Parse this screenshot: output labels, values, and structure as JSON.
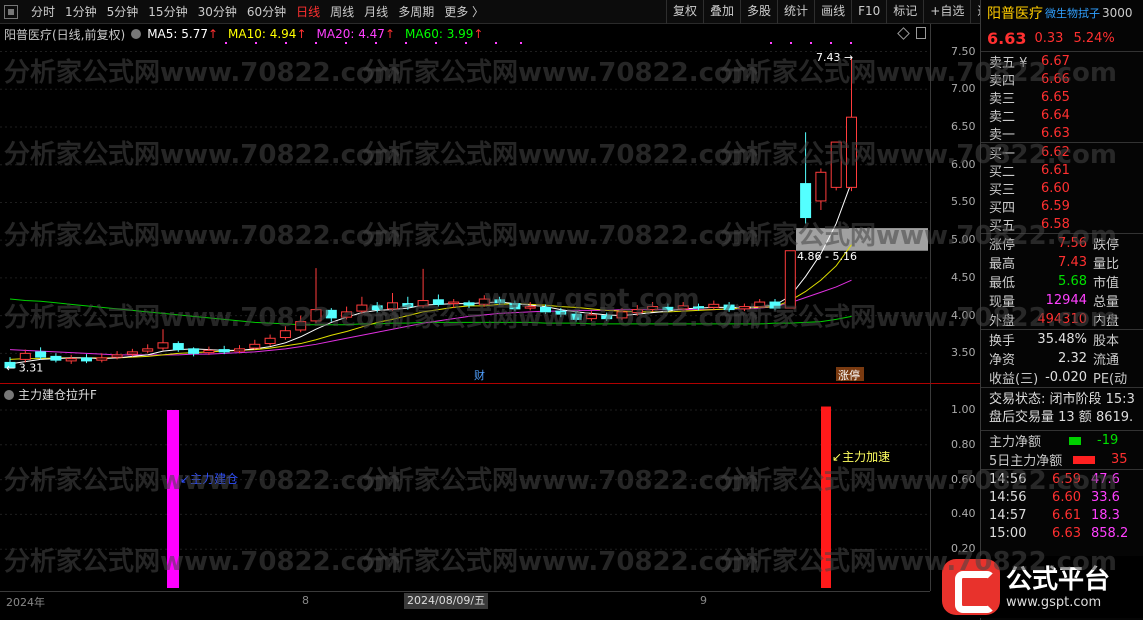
{
  "toolbar": {
    "periods": [
      "分时",
      "1分钟",
      "5分钟",
      "15分钟",
      "30分钟",
      "60分钟",
      "日线",
      "周线",
      "月线",
      "多周期",
      "更多 〉"
    ],
    "active_index": 6,
    "buttons": [
      "复权",
      "叠加",
      "多股",
      "统计",
      "画线",
      "F10",
      "标记",
      "+自选",
      "返回"
    ]
  },
  "chart_header": {
    "stock": "阳普医疗(日线,前复权)",
    "ma5": "MA5: 5.77",
    "ma10": "MA10: 4.94",
    "ma20": "MA20: 4.47",
    "ma60": "MA60: 3.99",
    "arrow": "↑"
  },
  "price_axis": [
    "7.50",
    "7.00",
    "6.50",
    "6.00",
    "5.50",
    "5.00",
    "4.50",
    "4.00",
    "3.50"
  ],
  "annotations": {
    "high": "7.43",
    "low": "3.31",
    "range": "4.86 - 5.16",
    "marker_cai": "财",
    "marker_limit": "涨停"
  },
  "sub_indicator": {
    "title": "主力建仓拉升F",
    "signal_left": "主力建仓",
    "signal_right": "主力加速",
    "axis": [
      "1.00",
      "0.80",
      "0.60",
      "0.40",
      "0.20"
    ],
    "bar_values": [
      1.0,
      1.02
    ]
  },
  "date_axis": {
    "labels": [
      "2024年",
      "8",
      "9"
    ],
    "cursor": "2024/08/09/五"
  },
  "chart_data": {
    "type": "candlestick",
    "series": [
      {
        "name": "MA5",
        "color": "#ffffff"
      },
      {
        "name": "MA10",
        "color": "#ffff00"
      },
      {
        "name": "MA20",
        "color": "#ff40ff"
      },
      {
        "name": "MA60",
        "color": "#00ff00"
      }
    ],
    "ylim": [
      3.2,
      7.6
    ],
    "candles": [
      [
        3.38,
        3.31,
        3.45,
        3.3
      ],
      [
        3.42,
        3.5,
        3.55,
        3.38
      ],
      [
        3.52,
        3.45,
        3.58,
        3.42
      ],
      [
        3.46,
        3.41,
        3.5,
        3.38
      ],
      [
        3.4,
        3.43,
        3.48,
        3.36
      ],
      [
        3.44,
        3.4,
        3.49,
        3.37
      ],
      [
        3.41,
        3.44,
        3.5,
        3.38
      ],
      [
        3.45,
        3.48,
        3.53,
        3.42
      ],
      [
        3.49,
        3.52,
        3.56,
        3.46
      ],
      [
        3.53,
        3.56,
        3.62,
        3.5
      ],
      [
        3.57,
        3.64,
        3.82,
        3.54
      ],
      [
        3.63,
        3.55,
        3.66,
        3.52
      ],
      [
        3.56,
        3.5,
        3.58,
        3.46
      ],
      [
        3.51,
        3.54,
        3.59,
        3.48
      ],
      [
        3.55,
        3.52,
        3.6,
        3.49
      ],
      [
        3.53,
        3.56,
        3.61,
        3.5
      ],
      [
        3.57,
        3.62,
        3.68,
        3.55
      ],
      [
        3.63,
        3.7,
        3.75,
        3.6
      ],
      [
        3.71,
        3.8,
        3.86,
        3.68
      ],
      [
        3.81,
        3.92,
        4.0,
        3.78
      ],
      [
        3.93,
        4.08,
        4.63,
        3.9
      ],
      [
        4.07,
        3.97,
        4.1,
        3.92
      ],
      [
        3.98,
        4.05,
        4.12,
        3.95
      ],
      [
        4.06,
        4.14,
        4.25,
        4.02
      ],
      [
        4.13,
        4.08,
        4.18,
        4.04
      ],
      [
        4.09,
        4.17,
        4.3,
        4.06
      ],
      [
        4.16,
        4.12,
        4.25,
        4.08
      ],
      [
        4.13,
        4.2,
        4.62,
        4.1
      ],
      [
        4.21,
        4.15,
        4.28,
        4.12
      ],
      [
        4.16,
        4.18,
        4.22,
        4.1
      ],
      [
        4.17,
        4.14,
        4.2,
        4.1
      ],
      [
        4.15,
        4.22,
        4.27,
        4.12
      ],
      [
        4.21,
        4.17,
        4.25,
        4.14
      ],
      [
        4.16,
        4.09,
        4.2,
        4.06
      ],
      [
        4.1,
        4.12,
        4.18,
        4.07
      ],
      [
        4.11,
        4.05,
        4.15,
        4.02
      ],
      [
        4.06,
        4.02,
        4.1,
        3.98
      ],
      [
        4.02,
        3.95,
        4.06,
        3.92
      ],
      [
        3.96,
        4.01,
        4.06,
        3.93
      ],
      [
        4.0,
        3.96,
        4.04,
        3.93
      ],
      [
        3.97,
        4.05,
        4.1,
        3.94
      ],
      [
        4.04,
        4.08,
        4.14,
        4.0
      ],
      [
        4.08,
        4.12,
        4.18,
        4.05
      ],
      [
        4.11,
        4.08,
        4.16,
        4.05
      ],
      [
        4.09,
        4.13,
        4.18,
        4.06
      ],
      [
        4.12,
        4.1,
        4.16,
        4.07
      ],
      [
        4.11,
        4.15,
        4.2,
        4.08
      ],
      [
        4.14,
        4.08,
        4.18,
        4.05
      ],
      [
        4.09,
        4.12,
        4.16,
        4.06
      ],
      [
        4.12,
        4.18,
        4.22,
        4.09
      ],
      [
        4.18,
        4.1,
        4.22,
        4.07
      ],
      [
        4.1,
        4.86,
        4.86,
        4.1
      ],
      [
        5.75,
        5.3,
        6.43,
        5.22
      ],
      [
        5.52,
        5.9,
        5.95,
        5.4
      ],
      [
        5.7,
        6.3,
        6.3,
        5.66
      ],
      [
        5.7,
        6.63,
        7.43,
        5.65
      ]
    ],
    "ma5": [
      3.36,
      3.39,
      3.42,
      3.43,
      3.44,
      3.44,
      3.43,
      3.44,
      3.46,
      3.48,
      3.53,
      3.55,
      3.56,
      3.55,
      3.54,
      3.54,
      3.56,
      3.59,
      3.64,
      3.72,
      3.82,
      3.91,
      3.98,
      4.04,
      4.07,
      4.08,
      4.1,
      4.14,
      4.15,
      4.16,
      4.16,
      4.17,
      4.18,
      4.16,
      4.14,
      4.12,
      4.08,
      4.05,
      4.03,
      4.01,
      4.0,
      4.02,
      4.04,
      4.06,
      4.09,
      4.1,
      4.11,
      4.11,
      4.11,
      4.12,
      4.14,
      4.26,
      4.52,
      4.82,
      5.22,
      5.77
    ],
    "ma10": [
      3.42,
      3.43,
      3.43,
      3.44,
      3.44,
      3.44,
      3.44,
      3.44,
      3.45,
      3.46,
      3.48,
      3.5,
      3.51,
      3.52,
      3.53,
      3.54,
      3.55,
      3.57,
      3.6,
      3.63,
      3.68,
      3.74,
      3.79,
      3.85,
      3.91,
      3.95,
      4.0,
      4.05,
      4.08,
      4.11,
      4.13,
      4.13,
      4.15,
      4.16,
      4.15,
      4.14,
      4.12,
      4.11,
      4.09,
      4.07,
      4.06,
      4.05,
      4.05,
      4.05,
      4.06,
      4.07,
      4.08,
      4.09,
      4.1,
      4.11,
      4.12,
      4.2,
      4.32,
      4.47,
      4.66,
      4.94
    ],
    "ma20": [
      3.55,
      3.54,
      3.53,
      3.52,
      3.51,
      3.5,
      3.49,
      3.48,
      3.48,
      3.48,
      3.48,
      3.48,
      3.49,
      3.49,
      3.5,
      3.51,
      3.52,
      3.54,
      3.56,
      3.59,
      3.62,
      3.66,
      3.7,
      3.74,
      3.78,
      3.82,
      3.86,
      3.9,
      3.93,
      3.96,
      3.99,
      4.01,
      4.03,
      4.04,
      4.05,
      4.06,
      4.06,
      4.07,
      4.07,
      4.07,
      4.08,
      4.08,
      4.08,
      4.08,
      4.08,
      4.08,
      4.08,
      4.09,
      4.09,
      4.1,
      4.12,
      4.17,
      4.24,
      4.31,
      4.38,
      4.47
    ],
    "ma60": [
      4.22,
      4.2,
      4.19,
      4.17,
      4.15,
      4.13,
      4.11,
      4.09,
      4.07,
      4.05,
      4.03,
      4.01,
      3.99,
      3.97,
      3.95,
      3.93,
      3.91,
      3.9,
      3.89,
      3.88,
      3.88,
      3.88,
      3.88,
      3.89,
      3.89,
      3.9,
      3.9,
      3.91,
      3.91,
      3.91,
      3.91,
      3.91,
      3.91,
      3.91,
      3.91,
      3.9,
      3.9,
      3.9,
      3.89,
      3.89,
      3.89,
      3.89,
      3.89,
      3.89,
      3.89,
      3.89,
      3.89,
      3.89,
      3.89,
      3.89,
      3.9,
      3.9,
      3.91,
      3.92,
      3.95,
      3.99
    ]
  },
  "quote": {
    "name": "阳普医疗",
    "alias": "微生物拭子",
    "code": "3000",
    "price": "6.63",
    "change": "0.33",
    "pct": "5.24%",
    "asks": [
      [
        "卖五 ¥",
        "6.67"
      ],
      [
        "卖四",
        "6.66"
      ],
      [
        "卖三",
        "6.65"
      ],
      [
        "卖二",
        "6.64"
      ],
      [
        "卖一",
        "6.63"
      ]
    ],
    "bids": [
      [
        "买一",
        "6.62"
      ],
      [
        "买二",
        "6.61"
      ],
      [
        "买三",
        "6.60"
      ],
      [
        "买四",
        "6.59"
      ],
      [
        "买五",
        "6.58"
      ]
    ],
    "stats": [
      [
        "涨停",
        "7.56",
        "red",
        "跌停"
      ],
      [
        "最高",
        "7.43",
        "red",
        "量比"
      ],
      [
        "最低",
        "5.68",
        "grn",
        "市值"
      ],
      [
        "现量",
        "12944",
        "mag",
        "总量"
      ],
      [
        "外盘",
        "494310",
        "red",
        "内盘"
      ]
    ],
    "stats2": [
      [
        "换手",
        "35.48%",
        "wht",
        "股本"
      ],
      [
        "净资",
        "2.32",
        "wht",
        "流通"
      ],
      [
        "收益(三)",
        "-0.020",
        "wht",
        "PE(动"
      ]
    ],
    "trade_state": "交易状态: 闭市阶段 15:3",
    "after_hours": "盘后交易量 13 额 8619.",
    "flow": [
      [
        "主力净额",
        "-19"
      ],
      [
        "5日主力净额",
        "35"
      ]
    ],
    "ticks": [
      [
        "14:56",
        "6.59",
        "47.6"
      ],
      [
        "14:56",
        "6.60",
        "33.6"
      ],
      [
        "14:57",
        "6.61",
        "18.3"
      ],
      [
        "15:00",
        "6.63",
        "858.2"
      ]
    ]
  },
  "watermark": {
    "text": "分析家公式网www.70822.com",
    "center": "www.gspt.com",
    "logo_title": "公式平台",
    "logo_url": "www.gspt.com"
  }
}
